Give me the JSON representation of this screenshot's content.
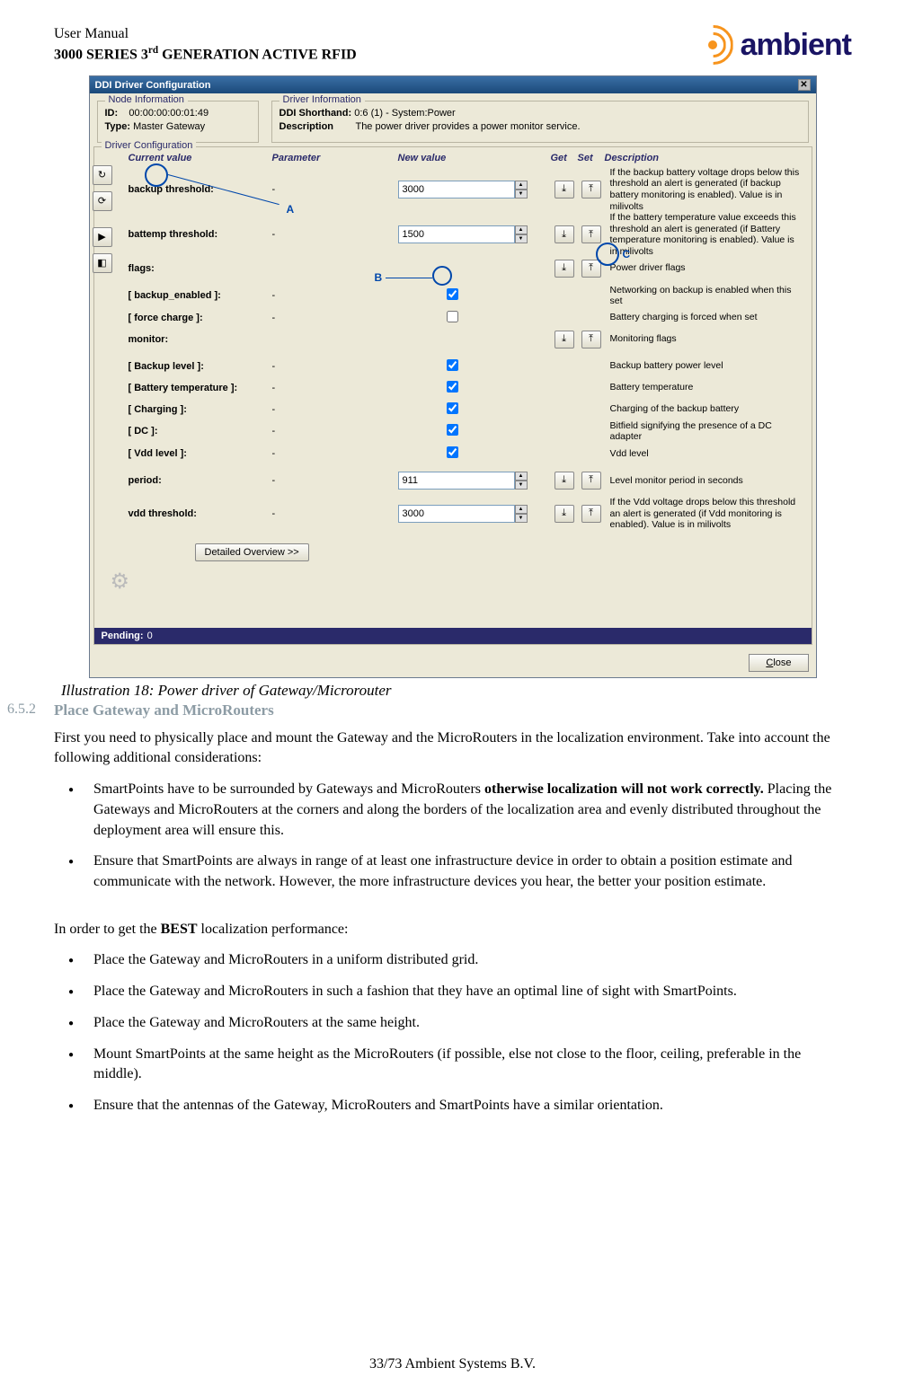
{
  "header": {
    "line1": "User Manual",
    "line2_a": "3000 SERIES 3",
    "line2_sup": "rd",
    "line2_b": " GENERATION ACTIVE RFID",
    "logo_text": "ambient"
  },
  "dialog": {
    "title": "DDI Driver Configuration",
    "node_info_title": "Node Information",
    "node_id_label": "ID:",
    "node_id": "00:00:00:00:01:49",
    "node_type_label": "Type:",
    "node_type": "Master Gateway",
    "driver_info_title": "Driver Information",
    "shorthand_label": "DDI Shorthand:",
    "shorthand": "0:6 (1) - System:Power",
    "desc_label": "Description",
    "desc": "The power driver provides a power monitor service.",
    "cfg_title": "Driver Configuration",
    "heads": {
      "cur": "Current value",
      "param": "Parameter",
      "newv": "New value",
      "get": "Get",
      "set": "Set",
      "descr": "Description"
    },
    "rows": [
      {
        "param": "backup threshold:",
        "cur": "-",
        "newv": "3000",
        "type": "spin",
        "get": true,
        "set": true,
        "desc": "If the backup battery voltage drops below this threshold an alert is generated (if backup battery monitoring is enabled). Value is in milivolts"
      },
      {
        "param": "battemp threshold:",
        "cur": "-",
        "newv": "1500",
        "type": "spin",
        "get": true,
        "set": true,
        "desc": "If the battery temperature value exceeds this threshold an alert is generated (if Battery temperature monitoring is enabled). Value is in milivolts"
      },
      {
        "param": "flags:",
        "cur": "",
        "newv": "",
        "type": "none",
        "get": true,
        "set": true,
        "desc": "Power driver flags"
      },
      {
        "param": "[ backup_enabled ]:",
        "cur": "-",
        "newv": "",
        "type": "check",
        "checked": true,
        "get": false,
        "set": false,
        "desc": "Networking on backup is enabled when this set"
      },
      {
        "param": "[ force charge ]:",
        "cur": "-",
        "newv": "",
        "type": "check",
        "checked": false,
        "get": false,
        "set": false,
        "desc": "Battery charging is forced when set"
      },
      {
        "param": "monitor:",
        "cur": "",
        "newv": "",
        "type": "none",
        "get": true,
        "set": true,
        "desc": "Monitoring flags"
      },
      {
        "param": "[ Backup level ]:",
        "cur": "-",
        "newv": "",
        "type": "check",
        "checked": true,
        "get": false,
        "set": false,
        "desc": "Backup battery power level"
      },
      {
        "param": "[ Battery temperature ]:",
        "cur": "-",
        "newv": "",
        "type": "check",
        "checked": true,
        "get": false,
        "set": false,
        "desc": "Battery temperature"
      },
      {
        "param": "[ Charging ]:",
        "cur": "-",
        "newv": "",
        "type": "check",
        "checked": true,
        "get": false,
        "set": false,
        "desc": "Charging of the backup battery"
      },
      {
        "param": "[ DC ]:",
        "cur": "-",
        "newv": "",
        "type": "check",
        "checked": true,
        "get": false,
        "set": false,
        "desc": "Bitfield signifying the presence of a DC adapter"
      },
      {
        "param": "[ Vdd level ]:",
        "cur": "-",
        "newv": "",
        "type": "check",
        "checked": true,
        "get": false,
        "set": false,
        "desc": "Vdd level"
      },
      {
        "param": "period:",
        "cur": "-",
        "newv": "911",
        "type": "spin",
        "get": true,
        "set": true,
        "desc": "Level monitor period in seconds"
      },
      {
        "param": "vdd threshold:",
        "cur": "-",
        "newv": "3000",
        "type": "spin",
        "get": true,
        "set": true,
        "desc": "If the Vdd voltage drops below this threshold an alert is generated (if Vdd monitoring is enabled). Value is in milivolts"
      }
    ],
    "overview_btn": "Detailed Overview >>",
    "pending_label": "Pending:",
    "pending_value": "0",
    "close_btn": "Close",
    "ann": {
      "A": "A",
      "B": "B",
      "C": "C"
    }
  },
  "caption": "Illustration 18: Power driver of Gateway/Microrouter",
  "section": {
    "num": "6.5.2",
    "title": "Place Gateway and MicroRouters"
  },
  "p1": "First you need to physically place and mount the Gateway and the MicroRouters in the localization environment. Take into account the following additional considerations:",
  "list1": [
    {
      "pre": "SmartPoints have to be surrounded by Gateways and MicroRouters ",
      "bold": "otherwise localization will not work correctly.",
      "post": " Placing the Gateways and MicroRouters at the corners and along the borders of the localization area and evenly distributed throughout the deployment area will ensure this."
    },
    {
      "pre": "Ensure that SmartPoints are always in range of at least one infrastructure device in order to obtain a position estimate and communicate with the network. However, the more infrastructure devices you hear, the better your position estimate.",
      "bold": "",
      "post": ""
    }
  ],
  "p2_pre": "In order to get the ",
  "p2_bold": "BEST",
  "p2_post": " localization performance:",
  "list2": [
    "Place the Gateway and MicroRouters in a uniform distributed grid.",
    "Place the Gateway and MicroRouters in such a fashion that they have an optimal line of sight with SmartPoints.",
    "Place the Gateway and MicroRouters at the same height.",
    "Mount SmartPoints at the same height as the MicroRouters (if possible, else not close to the floor, ceiling, preferable in the middle).",
    "Ensure that the antennas of the Gateway, MicroRouters and SmartPoints have a similar orientation."
  ],
  "footer": "33/73     Ambient Systems B.V."
}
